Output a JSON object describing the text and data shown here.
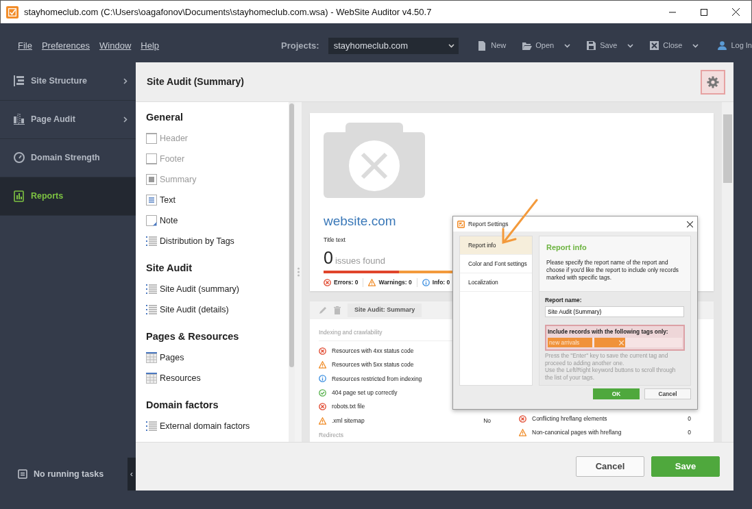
{
  "window": {
    "title": "stayhomeclub.com (C:\\Users\\oagafonov\\Documents\\stayhomeclub.com.wsa) - WebSite Auditor v4.50.7"
  },
  "menu": [
    {
      "label": "File"
    },
    {
      "label": "Preferences"
    },
    {
      "label": "Window"
    },
    {
      "label": "Help"
    }
  ],
  "projects": {
    "label": "Projects:",
    "value": "stayhomeclub.com"
  },
  "toolbar": [
    {
      "kind": "new",
      "label": "New",
      "dropdown": false
    },
    {
      "kind": "open",
      "label": "Open",
      "dropdown": true
    },
    {
      "kind": "save",
      "label": "Save",
      "dropdown": true
    },
    {
      "kind": "close",
      "label": "Close",
      "dropdown": true
    },
    {
      "kind": "user",
      "label": "Log In",
      "dropdown": false
    }
  ],
  "sidebar": {
    "items": [
      {
        "kind": "structure",
        "label": "Site Structure",
        "expandable": true,
        "selected": false
      },
      {
        "kind": "audit",
        "label": "Page Audit",
        "expandable": true,
        "selected": false
      },
      {
        "kind": "gauge",
        "label": "Domain Strength",
        "expandable": false,
        "selected": false
      },
      {
        "kind": "report",
        "label": "Reports",
        "expandable": false,
        "selected": true
      }
    ],
    "status": "No running tasks",
    "collapse": "‹"
  },
  "page": {
    "title": "Site Audit (Summary)"
  },
  "widgets": [
    {
      "title": "General",
      "items": [
        {
          "kind": "header",
          "label": "Header",
          "disabled": true
        },
        {
          "kind": "footer",
          "label": "Footer",
          "disabled": true
        },
        {
          "kind": "summary",
          "label": "Summary",
          "disabled": true
        },
        {
          "kind": "text",
          "label": "Text",
          "disabled": false
        },
        {
          "kind": "note",
          "label": "Note",
          "disabled": false
        },
        {
          "kind": "list",
          "label": "Distribution by Tags",
          "disabled": false
        }
      ]
    },
    {
      "title": "Site Audit",
      "items": [
        {
          "kind": "list",
          "label": "Site Audit (summary)",
          "disabled": false
        },
        {
          "kind": "list",
          "label": "Site Audit (details)",
          "disabled": false
        }
      ]
    },
    {
      "title": "Pages & Resources",
      "items": [
        {
          "kind": "table",
          "label": "Pages",
          "disabled": false
        },
        {
          "kind": "table",
          "label": "Resources",
          "disabled": false
        }
      ]
    },
    {
      "title": "Domain factors",
      "items": [
        {
          "kind": "list",
          "label": "External domain factors",
          "disabled": false
        }
      ]
    }
  ],
  "preview": {
    "site": "website.com",
    "subtitle": "Title text",
    "issues_count": "0",
    "issues_label": "issues found",
    "counts": [
      {
        "kind": "error",
        "label": "Errors: 0"
      },
      {
        "kind": "warning",
        "label": "Warnings: 0"
      },
      {
        "kind": "info",
        "label": "Info: 0"
      }
    ],
    "section_title": "Site Audit: Summary",
    "left_rows": [
      {
        "kind": "heading",
        "label": "Indexing and crawlability"
      },
      {
        "kind": "error",
        "label": "Resources with 4xx status code"
      },
      {
        "kind": "warning",
        "label": "Resources with 5xx status code"
      },
      {
        "kind": "info",
        "label": "Resources restricted from indexing"
      },
      {
        "kind": "ok",
        "label": "404 page set up correctly"
      },
      {
        "kind": "error",
        "label": "robots.txt file"
      },
      {
        "kind": "warning",
        "label": ".xml sitemap",
        "value": "No"
      },
      {
        "kind": "heading",
        "label": "Redirects"
      }
    ],
    "right_rows": [
      {
        "kind": "error",
        "label": "Conflicting hreflang elements",
        "value": "0"
      },
      {
        "kind": "warning",
        "label": "Non-canonical pages with hreflang",
        "value": "0"
      }
    ]
  },
  "dialog": {
    "title": "Report Settings",
    "tabs": [
      {
        "label": "Report info",
        "selected": true
      },
      {
        "label": "Color and Font settings",
        "selected": false
      },
      {
        "label": "Localization",
        "selected": false
      }
    ],
    "heading": "Report info",
    "description": "Please specify the report name of the report and choose if you'd like the report to include only records marked with specific tags.",
    "name_label": "Report name:",
    "name_value": "Site Audit (Summary)",
    "tags_label": "Include records with the following tags only:",
    "tags": [
      {
        "label": "new arrivals",
        "removable": false
      },
      {
        "removable": true
      }
    ],
    "hints": [
      "Press the \"Enter\" key to save the current tag and proceed to adding another one.",
      "Use the Left/Right keyword buttons to scroll through the list of your tags."
    ],
    "buttons": [
      {
        "label": "OK",
        "kind": "primary"
      },
      {
        "label": "Cancel",
        "kind": "secondary"
      }
    ]
  },
  "footer_buttons": [
    {
      "label": "Cancel",
      "kind": "secondary"
    },
    {
      "label": "Save",
      "kind": "primary"
    }
  ]
}
